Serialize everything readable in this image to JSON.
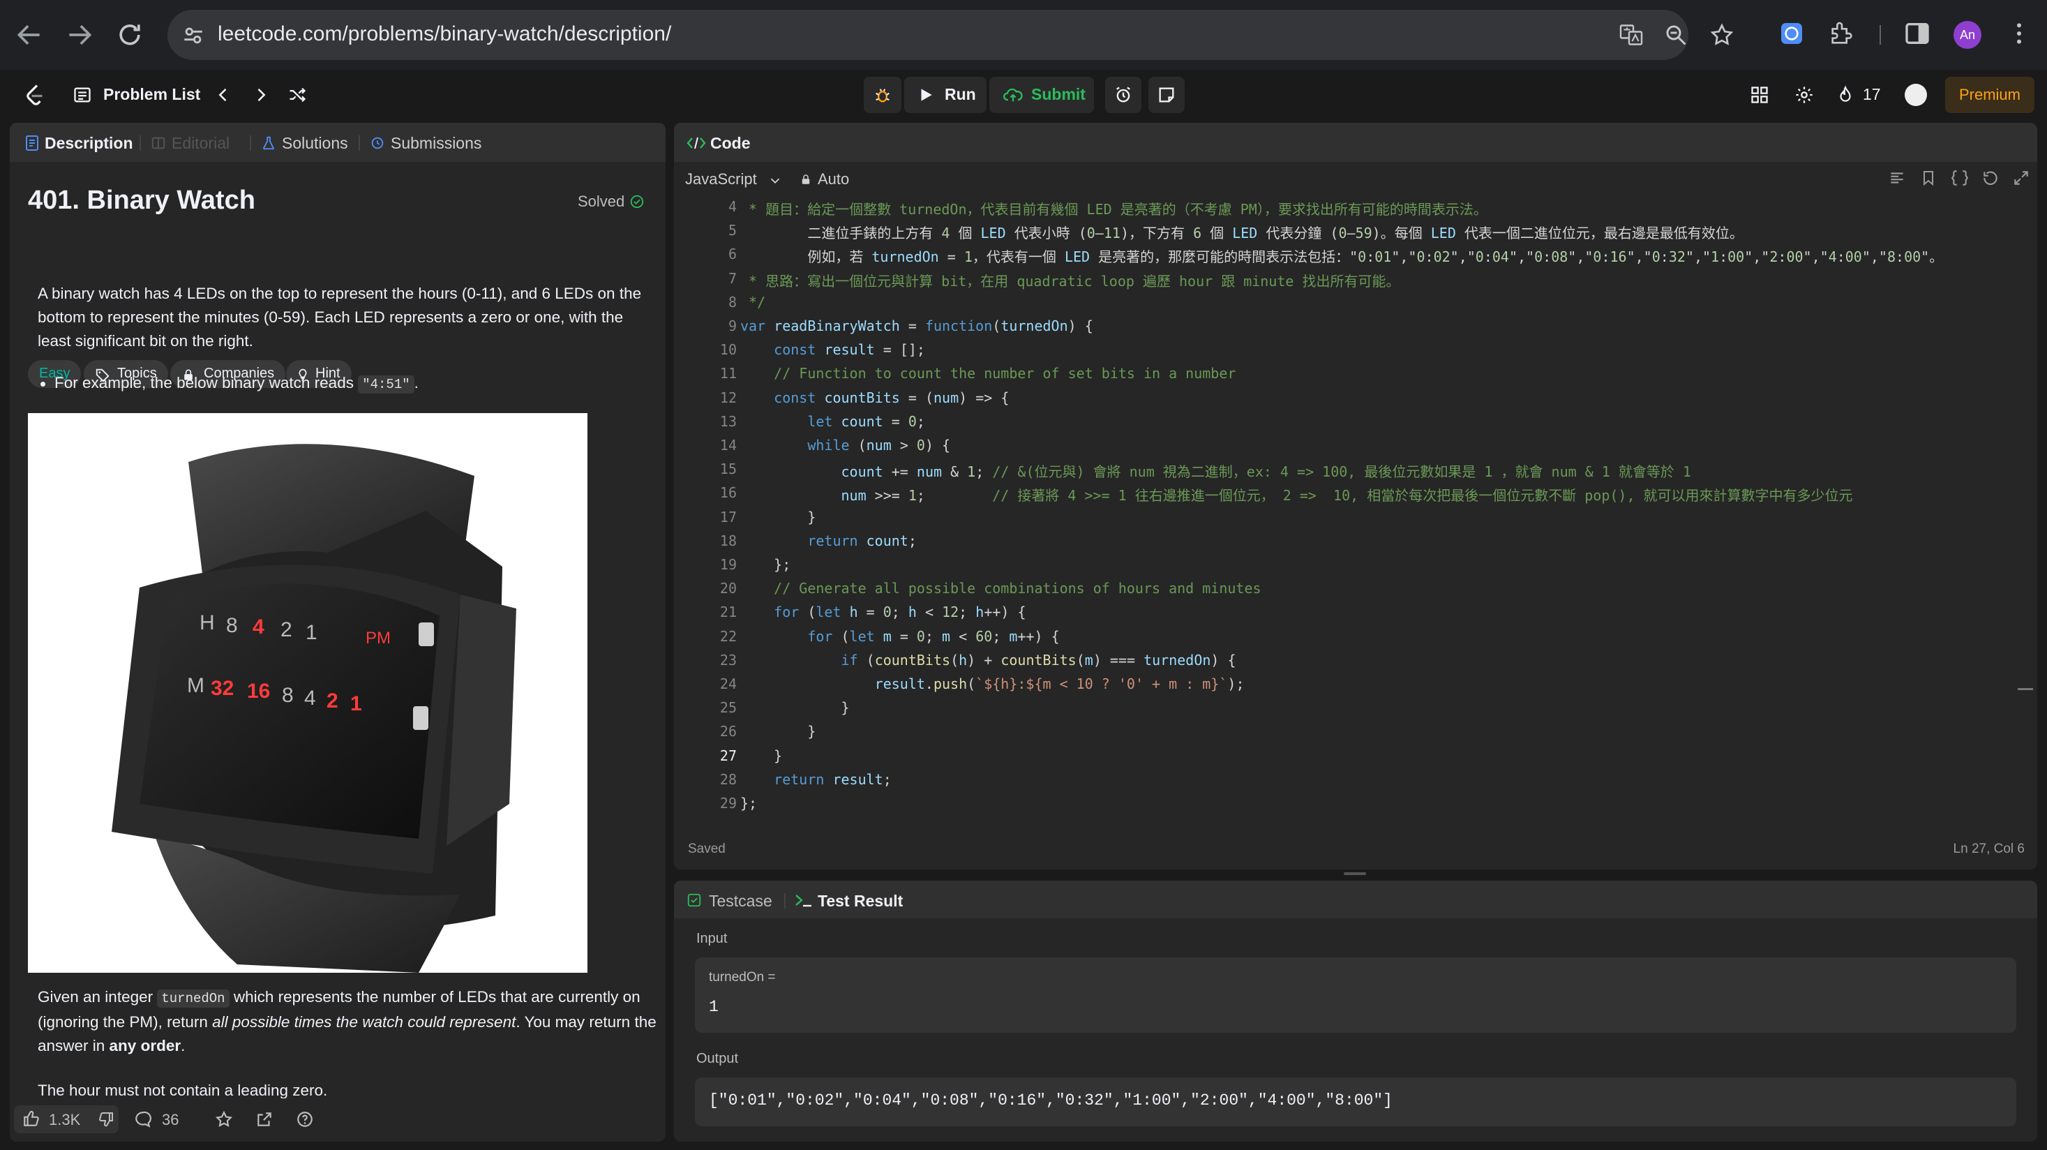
{
  "browser": {
    "url": "leetcode.com/problems/binary-watch/description/",
    "profile_initials": "An"
  },
  "nav": {
    "problem_list": "Problem List",
    "run": "Run",
    "submit": "Submit",
    "streak": "17",
    "premium": "Premium"
  },
  "left": {
    "tabs": [
      "Description",
      "Editorial",
      "Solutions",
      "Submissions"
    ],
    "title": "401. Binary Watch",
    "status": "Solved",
    "tags": [
      "Easy",
      "Topics",
      "Companies",
      "Hint"
    ],
    "para1": "A binary watch has 4 LEDs on the top to represent the hours (0-11), and 6 LEDs on the bottom to represent the minutes (0-59). Each LED represents a zero or one, with the least significant bit on the right.",
    "bullet_prefix": "For example, the below binary watch reads ",
    "bullet_code": "\"4:51\"",
    "bullet_suffix": ".",
    "watch": {
      "top_row": [
        "H",
        "8",
        "4",
        "2",
        "1",
        "PM"
      ],
      "bottom_row": [
        "M",
        "32",
        "16",
        "8",
        "4",
        "2",
        "1"
      ]
    },
    "para2_a": "Given an integer ",
    "para2_code": "turnedOn",
    "para2_b": " which represents the number of LEDs that are currently on (ignoring the PM), return ",
    "para2_em": "all possible times the watch could represent",
    "para2_c": ". You may return the answer in ",
    "para2_strong": "any order",
    "para2_d": ".",
    "para3": "The hour must not contain a leading zero.",
    "likes": "1.3K",
    "comments": "36"
  },
  "code_panel": {
    "title": "Code",
    "language": "JavaScript",
    "mode": "Auto",
    "status_saved": "Saved",
    "cursor": "Ln 27, Col 6",
    "lines": [
      {
        "n": "4",
        "t": " * 題目：給定一個整數 turnedOn，代表目前有幾個 LED 是亮著的（不考慮 PM），要求找出所有可能的時間表示法。"
      },
      {
        "n": "5",
        "t": "        二進位手錶的上方有 4 個 LED 代表小時 (0–11)，下方有 6 個 LED 代表分鐘 (0–59)。每個 LED 代表一個二進位位元，最右邊是最低有效位。"
      },
      {
        "n": "6",
        "t": "        例如，若 turnedOn = 1，代表有一個 LED 是亮著的，那麼可能的時間表示法包括：\"0:01\",\"0:02\",\"0:04\",\"0:08\",\"0:16\",\"0:32\",\"1:00\",\"2:00\",\"4:00\",\"8:00\"。"
      },
      {
        "n": "7",
        "t": " * 思路：寫出一個位元與計算 bit，在用 quadratic loop 遍歷 hour 跟 minute 找出所有可能。"
      },
      {
        "n": "8",
        "t": " */"
      },
      {
        "n": "9",
        "t": "var readBinaryWatch = function(turnedOn) {"
      },
      {
        "n": "10",
        "t": "    const result = [];"
      },
      {
        "n": "11",
        "t": "    // Function to count the number of set bits in a number"
      },
      {
        "n": "12",
        "t": "    const countBits = (num) => {"
      },
      {
        "n": "13",
        "t": "        let count = 0;"
      },
      {
        "n": "14",
        "t": "        while (num > 0) {"
      },
      {
        "n": "15",
        "t": "            count += num & 1; // &(位元與) 會將 num 視為二進制，ex: 4 => 100, 最後位元數如果是 1 ，就會 num & 1 就會等於 1"
      },
      {
        "n": "16",
        "t": "            num >>= 1;        // 接著將 4 >>= 1 往右邊推進一個位元， 2 =>  10, 相當於每次把最後一個位元數不斷 pop(), 就可以用來計算數字中有多少位元"
      },
      {
        "n": "17",
        "t": "        }"
      },
      {
        "n": "18",
        "t": "        return count;"
      },
      {
        "n": "19",
        "t": "    };"
      },
      {
        "n": "20",
        "t": "    // Generate all possible combinations of hours and minutes"
      },
      {
        "n": "21",
        "t": "    for (let h = 0; h < 12; h++) {"
      },
      {
        "n": "22",
        "t": "        for (let m = 0; m < 60; m++) {"
      },
      {
        "n": "23",
        "t": "            if (countBits(h) + countBits(m) === turnedOn) {"
      },
      {
        "n": "24",
        "t": "                result.push(`${h}:${m < 10 ? '0' + m : m}`);"
      },
      {
        "n": "25",
        "t": "            }"
      },
      {
        "n": "26",
        "t": "        }"
      },
      {
        "n": "27",
        "t": "    }"
      },
      {
        "n": "28",
        "t": "    return result;"
      },
      {
        "n": "29",
        "t": "};"
      }
    ]
  },
  "test_panel": {
    "tab_testcase": "Testcase",
    "tab_result": "Test Result",
    "input_label": "Input",
    "var_label": "turnedOn =",
    "var_value": "1",
    "output_label": "Output",
    "output_value": "[\"0:01\",\"0:02\",\"0:04\",\"0:08\",\"0:16\",\"0:32\",\"1:00\",\"2:00\",\"4:00\",\"8:00\"]"
  },
  "colors": {
    "accent_green": "#2cbb5d",
    "easy": "#00b8a3",
    "premium": "#ffa116",
    "led_red": "#ff3b3b"
  }
}
